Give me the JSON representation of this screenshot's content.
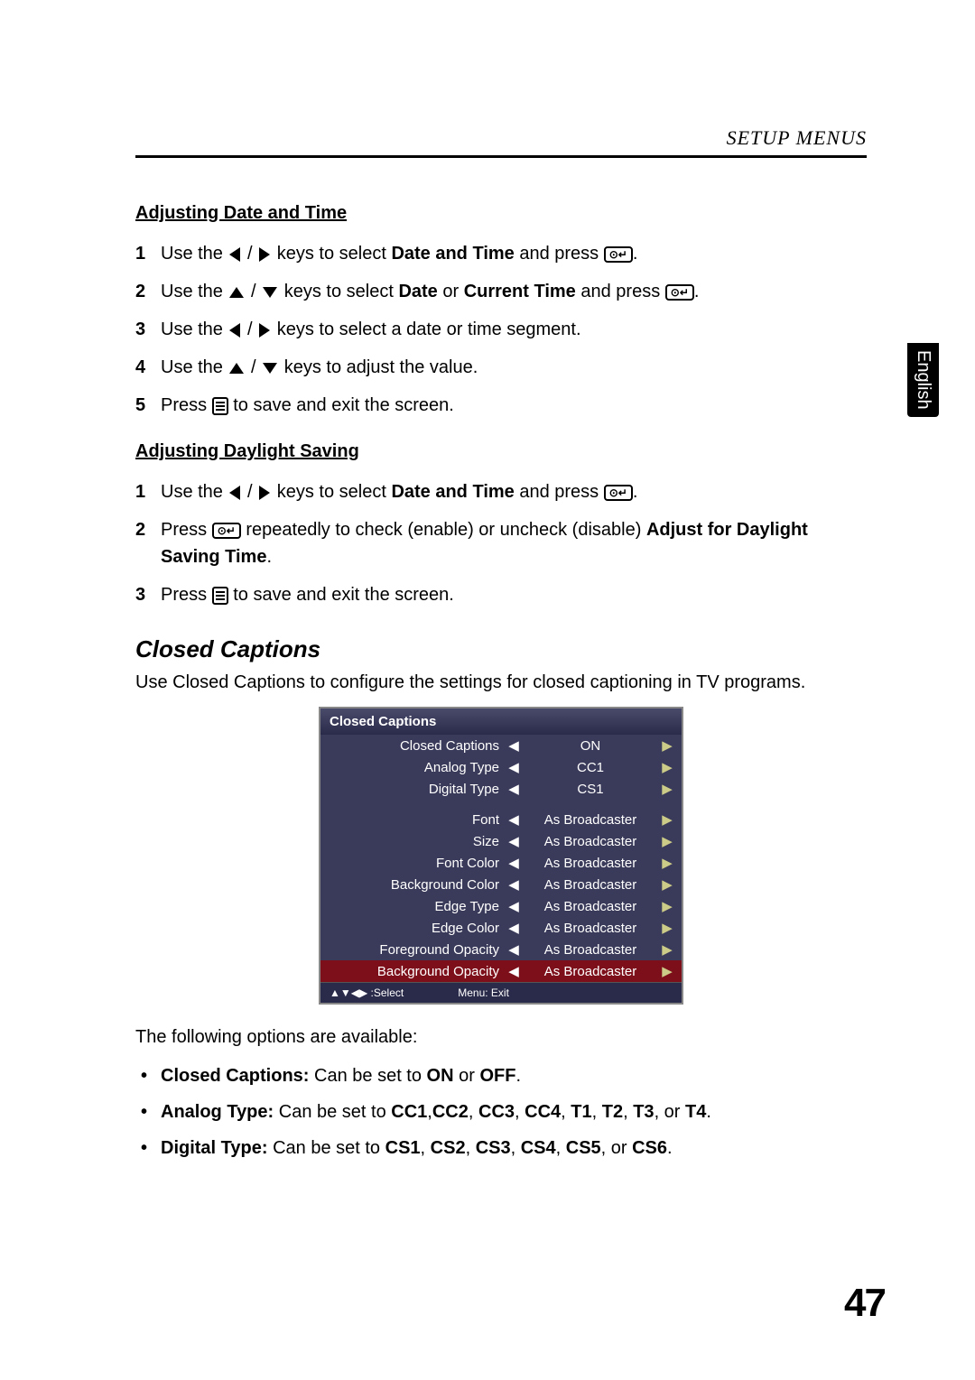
{
  "header": "SETUP MENUS",
  "sideTab": "English",
  "section1": {
    "title": "Adjusting Date and Time",
    "steps": {
      "s1a": "Use the ",
      "s1b": " keys to select ",
      "s1c": "Date and Time",
      "s1d": " and press ",
      "s2a": "Use the ",
      "s2b": " keys to select ",
      "s2c": "Date",
      "s2d": " or ",
      "s2e": "Current Time",
      "s2f": " and press ",
      "s3a": "Use the ",
      "s3b": " keys to select a date or time segment.",
      "s4a": "Use the ",
      "s4b": " keys to adjust the value.",
      "s5a": "Press ",
      "s5b": " to save and exit the screen."
    }
  },
  "section2": {
    "title": "Adjusting Daylight Saving",
    "steps": {
      "s1a": "Use the ",
      "s1b": " keys to select ",
      "s1c": "Date and Time",
      "s1d": " and press ",
      "s2a": "Press ",
      "s2b": " repeatedly to check (enable) or uncheck (disable) ",
      "s2c": "Adjust for Daylight Saving Time",
      "s3a": "Press ",
      "s3b": " to save and exit the screen."
    }
  },
  "closedCaptions": {
    "title": "Closed Captions",
    "intro": "Use Closed Captions to configure the settings for closed captioning in TV programs.",
    "panelTitle": "Closed Captions",
    "rows": [
      {
        "label": "Closed Captions",
        "value": "ON",
        "hl": false
      },
      {
        "label": "Analog Type",
        "value": "CC1",
        "hl": false
      },
      {
        "label": "Digital Type",
        "value": "CS1",
        "hl": false
      }
    ],
    "rows2": [
      {
        "label": "Font",
        "value": "As Broadcaster",
        "hl": false
      },
      {
        "label": "Size",
        "value": "As Broadcaster",
        "hl": false
      },
      {
        "label": "Font Color",
        "value": "As Broadcaster",
        "hl": false
      },
      {
        "label": "Background Color",
        "value": "As Broadcaster",
        "hl": false
      },
      {
        "label": "Edge Type",
        "value": "As Broadcaster",
        "hl": false
      },
      {
        "label": "Edge Color",
        "value": "As Broadcaster",
        "hl": false
      },
      {
        "label": "Foreground Opacity",
        "value": "As Broadcaster",
        "hl": false
      },
      {
        "label": "Background Opacity",
        "value": "As Broadcaster",
        "hl": true
      }
    ],
    "footerSelect": "▲▼◀▶ :Select",
    "footerExit": "Menu: Exit",
    "optionsIntro": "The following options are available:",
    "bullets": {
      "b1a": "Closed Captions:",
      "b1b": " Can be set to ",
      "b1c": "ON",
      "b1d": " or ",
      "b1e": "OFF",
      "b2a": "Analog Type:",
      "b2b": " Can be set to ",
      "b2c": "CC1",
      "b2d": "CC2",
      "b2e": "CC3",
      "b2f": "CC4",
      "b2g": "T1",
      "b2h": "T2",
      "b2i": "T3",
      "b2j": "T4",
      "b3a": "Digital Type:",
      "b3b": " Can be set to ",
      "b3c": "CS1",
      "b3d": "CS2",
      "b3e": "CS3",
      "b3f": "CS4",
      "b3g": "CS5",
      "b3h": "CS6"
    }
  },
  "pageNumber": "47"
}
